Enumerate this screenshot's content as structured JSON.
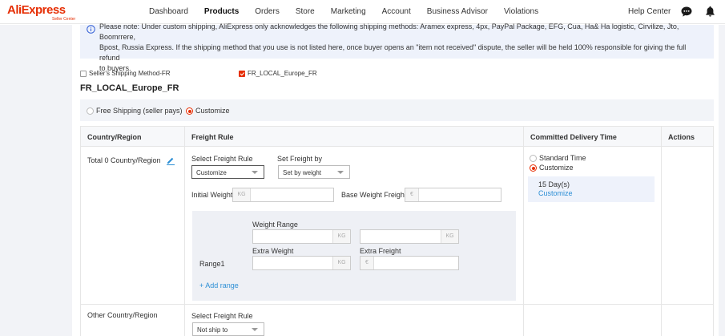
{
  "header": {
    "brand": "AliExpress",
    "brand_sub": "Seller Center",
    "nav": [
      "Dashboard",
      "Products",
      "Orders",
      "Store",
      "Marketing",
      "Account",
      "Business Advisor",
      "Violations"
    ],
    "active_nav": "Products",
    "help": "Help Center",
    "icons": [
      "chat-icon",
      "bell-icon"
    ]
  },
  "notice": {
    "line1": "Please note: Under custom shipping, AliExpress only acknowledges the following shipping methods: Aramex express, 4px, PayPal Package, EFG, Cua, Ha& Ha logistic, Cirvilize, Jto, Boomrrere,",
    "line2": "Bpost, Russia Express. If the shipping method that you use is not listed here, once buyer opens an \"item not received\" dispute, the seller will be held 100% responsible for giving the full refund",
    "line3": "to buyers."
  },
  "methods": [
    {
      "label": "Seller's Shipping Method-FR",
      "checked": false
    },
    {
      "label": "FR_LOCAL_Europe_FR",
      "checked": true
    }
  ],
  "section_title": "FR_LOCAL_Europe_FR",
  "shipping_options": {
    "free": "Free Shipping (seller pays)",
    "custom": "Customize",
    "selected": "Customize"
  },
  "table": {
    "headers": {
      "country": "Country/Region",
      "freight": "Freight Rule",
      "delivery": "Committed Delivery Time",
      "actions": "Actions"
    },
    "row1": {
      "country": "Total 0 Country/Region",
      "select_freight_label": "Select Freight Rule",
      "select_freight_value": "Customize",
      "set_freight_label": "Set Freight by",
      "set_freight_value": "Set by weight",
      "initial_weight_label": "Initial Weight",
      "initial_weight_unit": "KG",
      "initial_weight_value": "",
      "base_weight_label": "Base Weight Freight",
      "base_weight_unit": "€",
      "base_weight_value": "",
      "weight_range_label": "Weight Range",
      "range_unit_1": "KG",
      "range_unit_2": "KG",
      "extra_weight_label": "Extra Weight",
      "extra_weight_unit": "KG",
      "extra_freight_label": "Extra Freight",
      "extra_freight_unit": "€",
      "range_label": "Range1",
      "add_range": "+ Add range",
      "delivery_standard": "Standard Time",
      "delivery_custom": "Customize",
      "delivery_selected": "Customize",
      "days": "15 Day(s)",
      "days_link": "Customize"
    },
    "row2": {
      "country": "Other Country/Region",
      "select_freight_label": "Select Freight Rule",
      "select_freight_value": "Not ship to"
    }
  }
}
